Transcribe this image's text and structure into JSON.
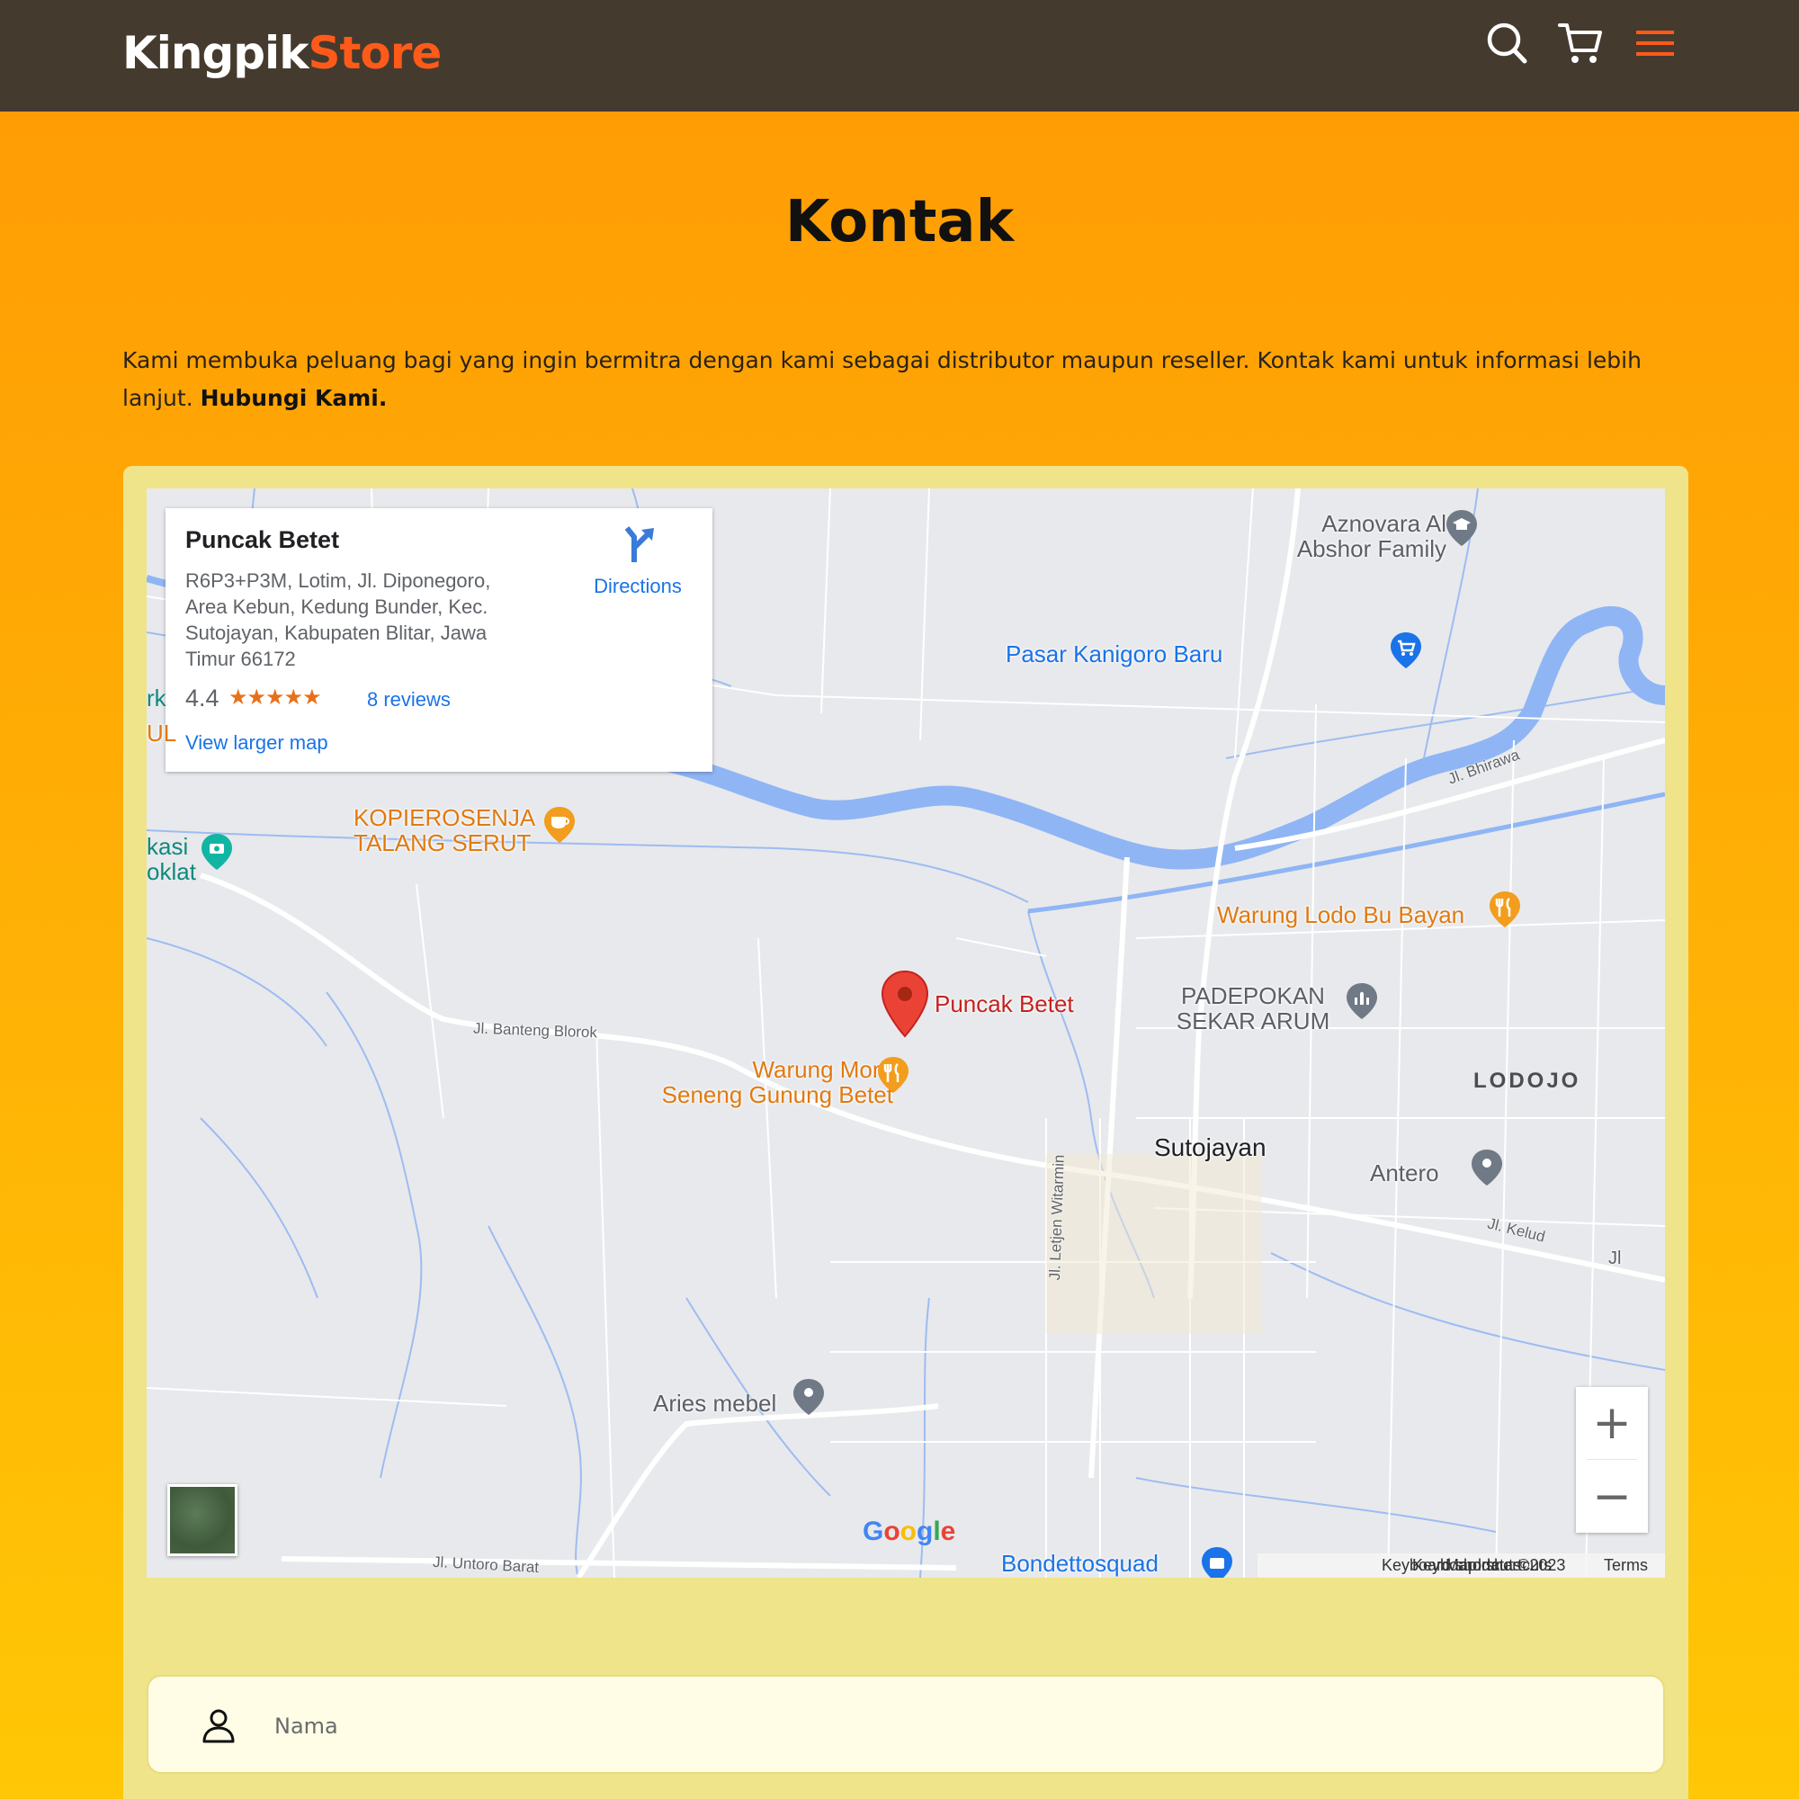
{
  "brand": {
    "part1": "Kingpik",
    "part2": "Store"
  },
  "nav": {
    "icons": [
      "search-icon",
      "cart-icon",
      "menu-icon"
    ]
  },
  "page": {
    "title": "Kontak",
    "intro_text": "Kami membuka peluang bagi yang ingin bermitra dengan kami sebagai distributor maupun reseller. Kontak kami untuk informasi lebih lanjut. ",
    "intro_link": "Hubungi Kami."
  },
  "map": {
    "card": {
      "place_name": "Puncak Betet",
      "address": "R6P3+P3M, Lotim, Jl. Diponegoro, Area Kebun, Kedung Bunder, Kec. Sutojayan, Kabupaten Blitar, Jawa Timur 66172",
      "rating": "4.4",
      "stars": "★★★★★",
      "reviews": "8 reviews",
      "larger_map": "View larger map",
      "directions": "Directions"
    },
    "labels": {
      "azno1": "Aznovara Al",
      "azno2": "Abshor Family",
      "pasar": "Pasar Kanigoro Baru",
      "kopi1": "KOPIEROSENJA",
      "kopi2": "TALANG SERUT",
      "lodo": "Warung Lodo Bu Bayan",
      "pin": "Puncak Betet",
      "pade1": "PADEPOKAN",
      "pade2": "SEKAR ARUM",
      "moro1": "Warung Moro",
      "moro2": "Seneng Gunung Betet",
      "lodojo": "LODOJO",
      "sutojayan": "Sutojayan",
      "antero": "Antero",
      "aries": "Aries mebel",
      "bondetto": "Bondettosquad",
      "edge_ul": "UL",
      "edge_rk": "rk",
      "edge_kasi1": "kasi",
      "edge_kasi2": "oklat",
      "edge_jl": "Jl"
    },
    "streets": {
      "banteng": "Jl. Banteng Blorok",
      "bhirawa": "Jl. Bhirawa",
      "kelud": "Jl. Kelud",
      "witarmin": "Jl. Letjen Witarmin",
      "untoro": "Jl. Untoro Barat"
    },
    "controls": {
      "zoom_in": "+",
      "zoom_out": "−"
    },
    "google": [
      "G",
      "o",
      "o",
      "g",
      "l",
      "e"
    ],
    "attribution": {
      "shortcuts": "Keyboard shortcuts",
      "mapdata": "Map data ©2023",
      "terms": "Terms"
    }
  },
  "form": {
    "name_placeholder": "Nama"
  },
  "colors": {
    "navbar": "#453a2e",
    "brand_accent": "#ff5a1a",
    "panel": "#efe48a",
    "bg_top": "#ff9a05",
    "bg_bottom": "#ffc705"
  }
}
